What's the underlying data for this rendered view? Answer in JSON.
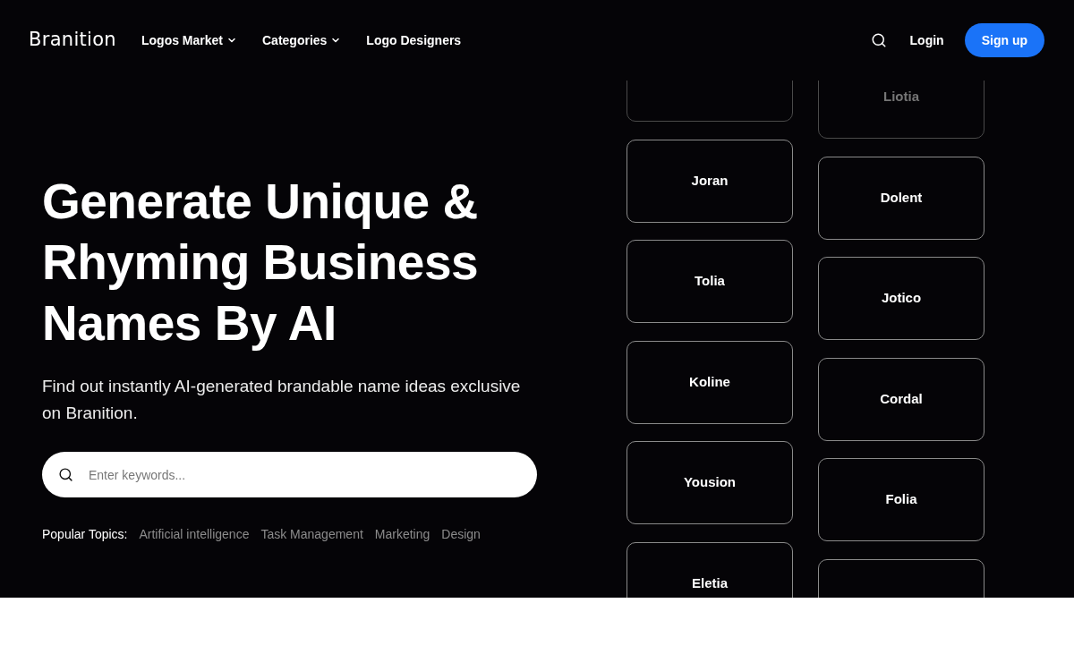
{
  "header": {
    "logo": "Branition",
    "nav": [
      {
        "label": "Logos Market",
        "dropdown": true
      },
      {
        "label": "Categories",
        "dropdown": true
      },
      {
        "label": "Logo Designers",
        "dropdown": false
      }
    ],
    "login": "Login",
    "signup": "Sign up"
  },
  "hero": {
    "title": "Generate Unique & Rhyming Business Names By AI",
    "subtitle": "Find out instantly AI-generated brandable name ideas exclusive on Branition.",
    "search": {
      "placeholder": "Enter keywords..."
    },
    "popular_label": "Popular Topics:",
    "topics": [
      "Artificial intelligence",
      "Task Management",
      "Marketing",
      "Design"
    ]
  },
  "name_columns": [
    {
      "cards": [
        {
          "kind": "blank",
          "faded": true
        },
        {
          "kind": "name",
          "name": "Joran",
          "faded": false
        },
        {
          "kind": "name",
          "name": "Tolia",
          "faded": false
        },
        {
          "kind": "name",
          "name": "Koline",
          "faded": false
        },
        {
          "kind": "name",
          "name": "Yousion",
          "faded": false
        },
        {
          "kind": "name",
          "name": "Eletia",
          "faded": false
        }
      ]
    },
    {
      "cards": [
        {
          "kind": "name",
          "name": "Liotia",
          "faded": true
        },
        {
          "kind": "name",
          "name": "Dolent",
          "faded": false
        },
        {
          "kind": "name",
          "name": "Jotico",
          "faded": false
        },
        {
          "kind": "name",
          "name": "Cordal",
          "faded": false
        },
        {
          "kind": "name",
          "name": "Folia",
          "faded": false
        },
        {
          "kind": "blank",
          "faded": false
        }
      ]
    }
  ]
}
